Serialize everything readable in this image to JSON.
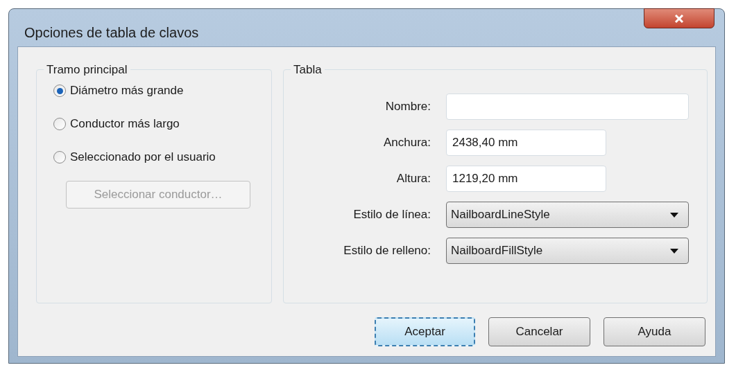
{
  "window": {
    "title": "Opciones de tabla de clavos"
  },
  "main_section": {
    "legend": "Tramo principal",
    "options": [
      {
        "label": "Diámetro más grande",
        "selected": true
      },
      {
        "label": "Conductor más largo",
        "selected": false
      },
      {
        "label": "Seleccionado por el usuario",
        "selected": false
      }
    ],
    "select_button": {
      "label": "Seleccionar conductor…",
      "disabled": true
    }
  },
  "table_section": {
    "legend": "Tabla",
    "fields": [
      {
        "kind": "text",
        "label": "Nombre:",
        "wide": true
      },
      {
        "kind": "text",
        "label": "Anchura:",
        "value": "2438,40 mm",
        "wide": false
      },
      {
        "kind": "text",
        "label": "Altura:",
        "value": "1219,20 mm",
        "wide": false
      },
      {
        "kind": "dropdown",
        "label": "Estilo de línea:",
        "value": "NailboardLineStyle",
        "wide": true
      },
      {
        "kind": "dropdown",
        "label": "Estilo de relleno:",
        "value": "NailboardFillStyle",
        "wide": true
      }
    ]
  },
  "buttons": [
    {
      "label": "Aceptar",
      "default": true
    },
    {
      "label": "Cancelar",
      "default": false
    },
    {
      "label": "Ayuda",
      "default": false
    }
  ]
}
